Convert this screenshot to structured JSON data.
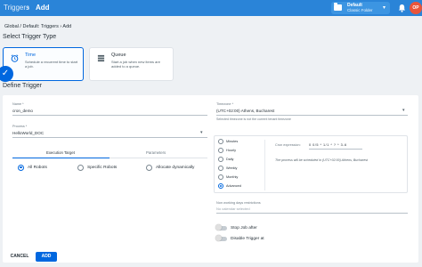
{
  "topbar": {
    "section": "Triggers",
    "separator": "›",
    "page": "Add"
  },
  "folder": {
    "label": "Default",
    "sublabel": "Classic Folder",
    "icon": "folder-icon"
  },
  "user": {
    "initials": "OP",
    "avatar_color": "#e8553b"
  },
  "breadcrumb": "Global / Default: Triggers › Add",
  "select_trigger_heading": "Select Trigger Type",
  "trigger_types": [
    {
      "title": "Time",
      "description": "Schedule a recurrent time to start a job.",
      "icon": "alarm-clock-icon",
      "selected": true
    },
    {
      "title": "Queue",
      "description": "Start a job when new items are added to a queue.",
      "icon": "queue-icon",
      "selected": false
    }
  ],
  "define_trigger_heading": "Define Trigger",
  "form": {
    "name_label": "Name *",
    "name_value": "cron_demo",
    "process_label": "Process *",
    "process_value": "HelloWorld_DOC",
    "timezone_label": "Timezone *",
    "timezone_value": "(UTC+02:00) Athens, Bucharest",
    "timezone_hint": "Selected timezone is not the current tenant timezone",
    "nonworking_label": "Non working days restrictions",
    "nonworking_placeholder": "No calendar selected"
  },
  "tabs": [
    "Execution Target",
    "Parameters"
  ],
  "execution_targets": [
    {
      "label": "All Robots",
      "selected": true
    },
    {
      "label": "Specific Robots",
      "selected": false
    },
    {
      "label": "Allocate dynamically",
      "selected": false
    }
  ],
  "frequencies": [
    {
      "label": "Minutes",
      "selected": false
    },
    {
      "label": "Hourly",
      "selected": false
    },
    {
      "label": "Daily",
      "selected": false
    },
    {
      "label": "Weekly",
      "selected": false
    },
    {
      "label": "Monthly",
      "selected": false
    },
    {
      "label": "Advanced",
      "selected": true
    }
  ],
  "cron": {
    "label": "Cron expression:",
    "value": "0 0/5 * 1/1 * ? * 3-6",
    "note": "The process will be scheduled in (UTC+02:00) Athens, Bucharest"
  },
  "toggles": [
    {
      "label": "Stop Job after",
      "on": false
    },
    {
      "label": "Disable Trigger at",
      "on": false
    }
  ],
  "buttons": {
    "cancel": "CANCEL",
    "add": "ADD"
  },
  "colors": {
    "topbar": "#2a84d8",
    "accent": "#0067df",
    "background": "#eef1f4"
  }
}
